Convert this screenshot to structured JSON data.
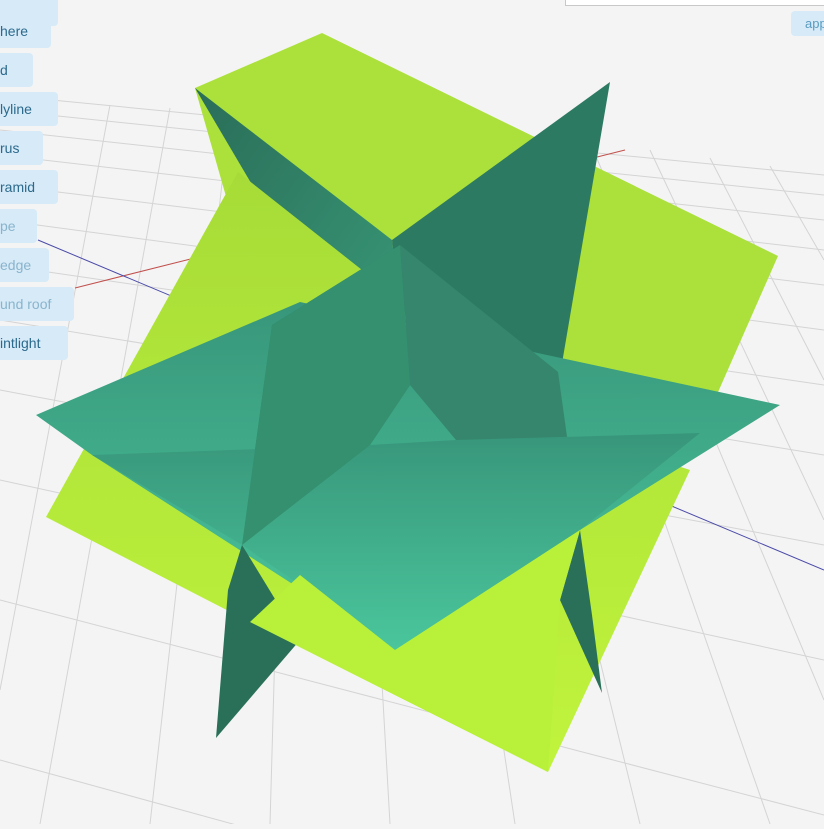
{
  "sidebar": {
    "items": [
      {
        "label": "",
        "name": "sidebar-item-top"
      },
      {
        "label": "here",
        "name": "sidebar-item-sphere"
      },
      {
        "label": "d",
        "name": "sidebar-item-grid"
      },
      {
        "label": "lyline",
        "name": "sidebar-item-polyline"
      },
      {
        "label": "rus",
        "name": "sidebar-item-torus"
      },
      {
        "label": "ramid",
        "name": "sidebar-item-pyramid"
      },
      {
        "label": "pe",
        "name": "sidebar-item-pipe"
      },
      {
        "label": "edge",
        "name": "sidebar-item-wedge"
      },
      {
        "label": "und roof",
        "name": "sidebar-item-round-roof"
      },
      {
        "label": "intlight",
        "name": "sidebar-item-pointlight"
      }
    ]
  },
  "header": {
    "app_button_label": "app"
  },
  "scene": {
    "background": "#f4f4f4",
    "grid_color": "#d2d2d2",
    "axis_x_color": "#c0504d",
    "axis_z_color": "#4a4aa8",
    "plane_light_color": "#b4ea3a",
    "plane_dark_color": "#2f7f66",
    "plane_mid_color": "#3aa384"
  }
}
